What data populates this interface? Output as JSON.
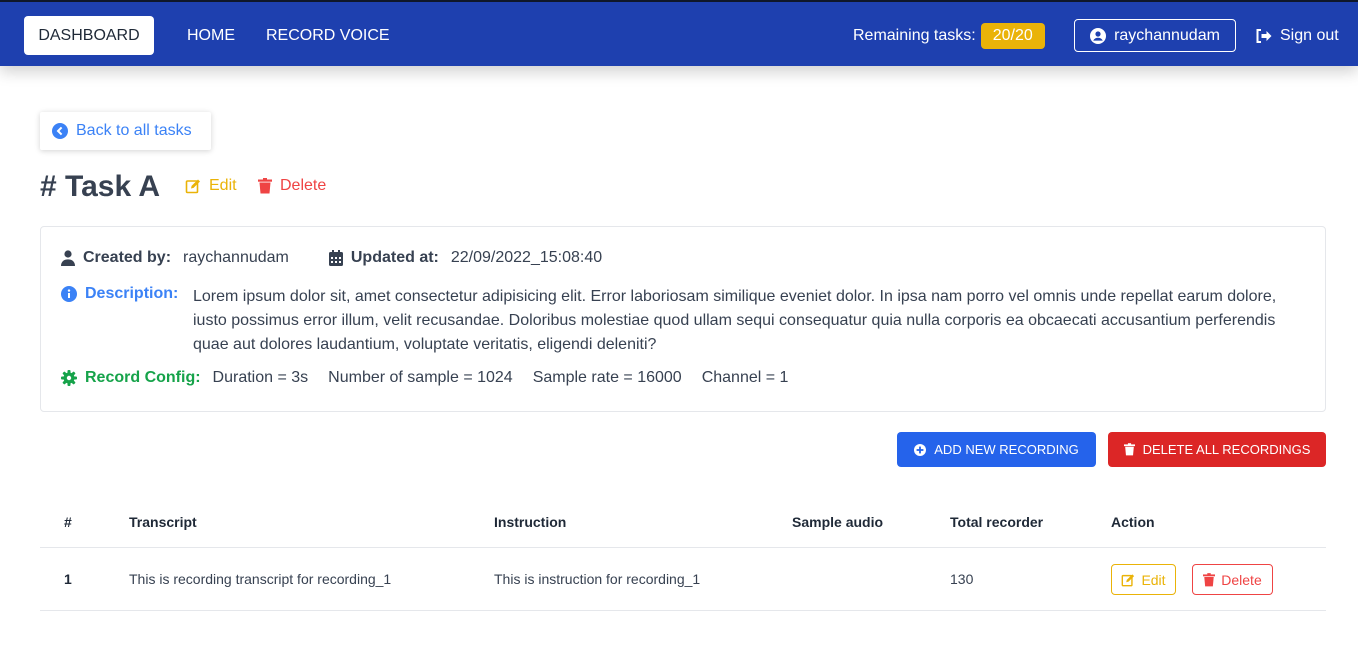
{
  "nav": {
    "dashboard": "DASHBOARD",
    "home": "HOME",
    "record_voice": "RECORD VOICE",
    "remaining_label": "Remaining tasks:",
    "remaining_value": "20/20",
    "username": "raychannudam",
    "signout": "Sign out"
  },
  "back": {
    "label": "Back to all tasks"
  },
  "task": {
    "title": "# Task A",
    "edit": "Edit",
    "delete": "Delete"
  },
  "info": {
    "created_by_label": "Created by:",
    "created_by_value": "raychannudam",
    "updated_at_label": "Updated at:",
    "updated_at_value": "22/09/2022_15:08:40",
    "description_label": "Description:",
    "description_text": "Lorem ipsum dolor sit, amet consectetur adipisicing elit. Error laboriosam similique eveniet dolor. In ipsa nam porro vel omnis unde repellat earum dolore, iusto possimus error illum, velit recusandae. Doloribus molestiae quod ullam sequi consequatur quia nulla corporis ea obcaecati accusantium perferendis quae aut dolores laudantium, voluptate veritatis, eligendi deleniti?",
    "config_label": "Record Config:",
    "config_items": [
      "Duration = 3s",
      "Number of sample = 1024",
      "Sample rate = 16000",
      "Channel = 1"
    ]
  },
  "actions": {
    "add": "ADD NEW RECORDING",
    "delete_all": "DELETE ALL RECORDINGS"
  },
  "table": {
    "headers": [
      "#",
      "Transcript",
      "Instruction",
      "Sample audio",
      "Total recorder",
      "Action"
    ],
    "rows": [
      {
        "num": "1",
        "transcript": "This is recording transcript for recording_1",
        "instruction": "This is instruction for recording_1",
        "sample_audio": "",
        "total": "130",
        "edit": "Edit",
        "delete": "Delete"
      }
    ]
  },
  "colors": {
    "navbar": "#1e40af",
    "badge": "#eab308",
    "primary": "#2563eb",
    "danger": "#dc2626",
    "success": "#16a34a"
  }
}
